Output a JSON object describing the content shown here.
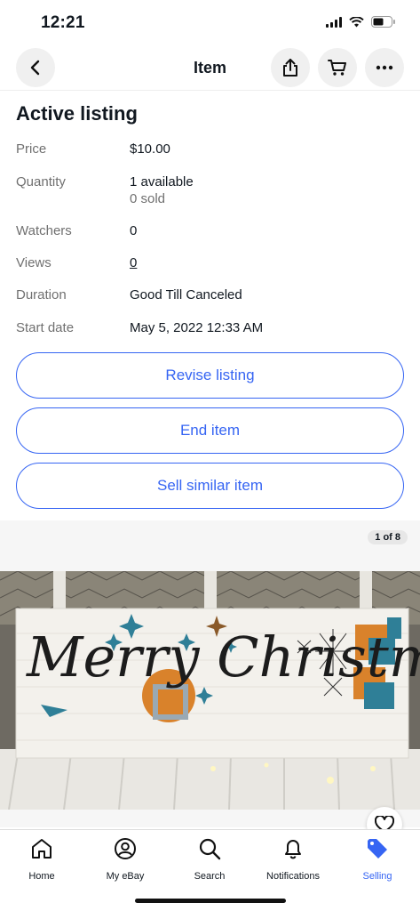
{
  "status_bar": {
    "time": "12:21"
  },
  "nav": {
    "title": "Item",
    "back_icon": "chevron-left-icon",
    "share_icon": "share-icon",
    "cart_icon": "cart-icon",
    "more_icon": "more-icon"
  },
  "listing": {
    "title": "Active listing",
    "rows": [
      {
        "label": "Price",
        "value": "$10.00"
      },
      {
        "label": "Quantity",
        "value": "1 available",
        "sub": "0 sold"
      },
      {
        "label": "Watchers",
        "value": "0"
      },
      {
        "label": "Views",
        "value": "0"
      },
      {
        "label": "Duration",
        "value": "Good Till Canceled"
      },
      {
        "label": "Start date",
        "value": "May 5, 2022 12:33 AM"
      }
    ]
  },
  "actions": {
    "revise": "Revise listing",
    "end": "End item",
    "sell_similar": "Sell similar item"
  },
  "gallery": {
    "counter": "1 of 8",
    "image_text": "Merry Christmas"
  },
  "tabs": [
    {
      "label": "Home",
      "icon": "home-icon"
    },
    {
      "label": "My eBay",
      "icon": "profile-icon"
    },
    {
      "label": "Search",
      "icon": "search-icon"
    },
    {
      "label": "Notifications",
      "icon": "bell-icon"
    },
    {
      "label": "Selling",
      "icon": "tag-icon"
    }
  ],
  "colors": {
    "accent": "#3665f3",
    "text": "#111820",
    "muted": "#707070"
  }
}
